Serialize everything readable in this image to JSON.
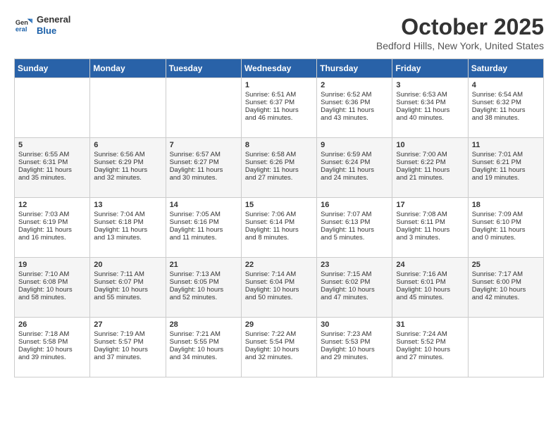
{
  "header": {
    "logo_general": "General",
    "logo_blue": "Blue",
    "month_title": "October 2025",
    "location": "Bedford Hills, New York, United States"
  },
  "days_of_week": [
    "Sunday",
    "Monday",
    "Tuesday",
    "Wednesday",
    "Thursday",
    "Friday",
    "Saturday"
  ],
  "weeks": [
    [
      {
        "day": "",
        "data": ""
      },
      {
        "day": "",
        "data": ""
      },
      {
        "day": "",
        "data": ""
      },
      {
        "day": "1",
        "data": "Sunrise: 6:51 AM\nSunset: 6:37 PM\nDaylight: 11 hours\nand 46 minutes."
      },
      {
        "day": "2",
        "data": "Sunrise: 6:52 AM\nSunset: 6:36 PM\nDaylight: 11 hours\nand 43 minutes."
      },
      {
        "day": "3",
        "data": "Sunrise: 6:53 AM\nSunset: 6:34 PM\nDaylight: 11 hours\nand 40 minutes."
      },
      {
        "day": "4",
        "data": "Sunrise: 6:54 AM\nSunset: 6:32 PM\nDaylight: 11 hours\nand 38 minutes."
      }
    ],
    [
      {
        "day": "5",
        "data": "Sunrise: 6:55 AM\nSunset: 6:31 PM\nDaylight: 11 hours\nand 35 minutes."
      },
      {
        "day": "6",
        "data": "Sunrise: 6:56 AM\nSunset: 6:29 PM\nDaylight: 11 hours\nand 32 minutes."
      },
      {
        "day": "7",
        "data": "Sunrise: 6:57 AM\nSunset: 6:27 PM\nDaylight: 11 hours\nand 30 minutes."
      },
      {
        "day": "8",
        "data": "Sunrise: 6:58 AM\nSunset: 6:26 PM\nDaylight: 11 hours\nand 27 minutes."
      },
      {
        "day": "9",
        "data": "Sunrise: 6:59 AM\nSunset: 6:24 PM\nDaylight: 11 hours\nand 24 minutes."
      },
      {
        "day": "10",
        "data": "Sunrise: 7:00 AM\nSunset: 6:22 PM\nDaylight: 11 hours\nand 21 minutes."
      },
      {
        "day": "11",
        "data": "Sunrise: 7:01 AM\nSunset: 6:21 PM\nDaylight: 11 hours\nand 19 minutes."
      }
    ],
    [
      {
        "day": "12",
        "data": "Sunrise: 7:03 AM\nSunset: 6:19 PM\nDaylight: 11 hours\nand 16 minutes."
      },
      {
        "day": "13",
        "data": "Sunrise: 7:04 AM\nSunset: 6:18 PM\nDaylight: 11 hours\nand 13 minutes."
      },
      {
        "day": "14",
        "data": "Sunrise: 7:05 AM\nSunset: 6:16 PM\nDaylight: 11 hours\nand 11 minutes."
      },
      {
        "day": "15",
        "data": "Sunrise: 7:06 AM\nSunset: 6:14 PM\nDaylight: 11 hours\nand 8 minutes."
      },
      {
        "day": "16",
        "data": "Sunrise: 7:07 AM\nSunset: 6:13 PM\nDaylight: 11 hours\nand 5 minutes."
      },
      {
        "day": "17",
        "data": "Sunrise: 7:08 AM\nSunset: 6:11 PM\nDaylight: 11 hours\nand 3 minutes."
      },
      {
        "day": "18",
        "data": "Sunrise: 7:09 AM\nSunset: 6:10 PM\nDaylight: 11 hours\nand 0 minutes."
      }
    ],
    [
      {
        "day": "19",
        "data": "Sunrise: 7:10 AM\nSunset: 6:08 PM\nDaylight: 10 hours\nand 58 minutes."
      },
      {
        "day": "20",
        "data": "Sunrise: 7:11 AM\nSunset: 6:07 PM\nDaylight: 10 hours\nand 55 minutes."
      },
      {
        "day": "21",
        "data": "Sunrise: 7:13 AM\nSunset: 6:05 PM\nDaylight: 10 hours\nand 52 minutes."
      },
      {
        "day": "22",
        "data": "Sunrise: 7:14 AM\nSunset: 6:04 PM\nDaylight: 10 hours\nand 50 minutes."
      },
      {
        "day": "23",
        "data": "Sunrise: 7:15 AM\nSunset: 6:02 PM\nDaylight: 10 hours\nand 47 minutes."
      },
      {
        "day": "24",
        "data": "Sunrise: 7:16 AM\nSunset: 6:01 PM\nDaylight: 10 hours\nand 45 minutes."
      },
      {
        "day": "25",
        "data": "Sunrise: 7:17 AM\nSunset: 6:00 PM\nDaylight: 10 hours\nand 42 minutes."
      }
    ],
    [
      {
        "day": "26",
        "data": "Sunrise: 7:18 AM\nSunset: 5:58 PM\nDaylight: 10 hours\nand 39 minutes."
      },
      {
        "day": "27",
        "data": "Sunrise: 7:19 AM\nSunset: 5:57 PM\nDaylight: 10 hours\nand 37 minutes."
      },
      {
        "day": "28",
        "data": "Sunrise: 7:21 AM\nSunset: 5:55 PM\nDaylight: 10 hours\nand 34 minutes."
      },
      {
        "day": "29",
        "data": "Sunrise: 7:22 AM\nSunset: 5:54 PM\nDaylight: 10 hours\nand 32 minutes."
      },
      {
        "day": "30",
        "data": "Sunrise: 7:23 AM\nSunset: 5:53 PM\nDaylight: 10 hours\nand 29 minutes."
      },
      {
        "day": "31",
        "data": "Sunrise: 7:24 AM\nSunset: 5:52 PM\nDaylight: 10 hours\nand 27 minutes."
      },
      {
        "day": "",
        "data": ""
      }
    ]
  ]
}
